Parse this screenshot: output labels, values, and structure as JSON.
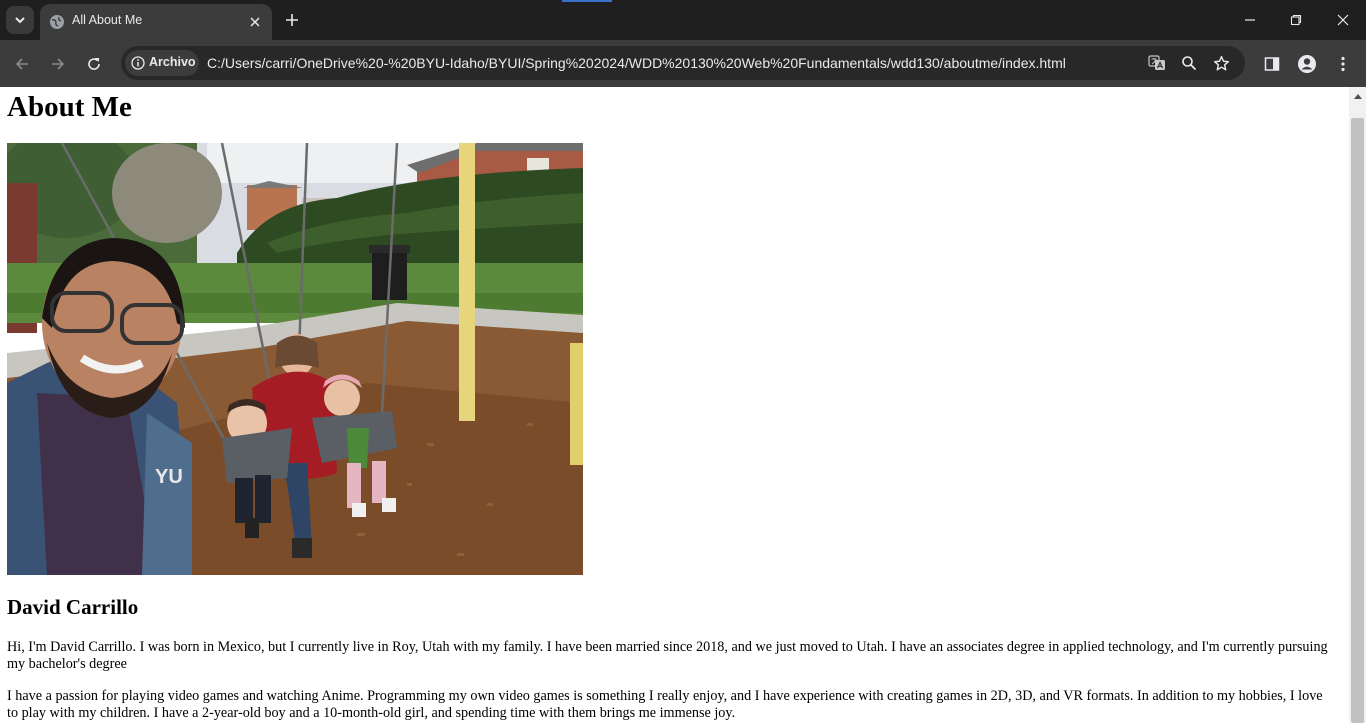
{
  "browser": {
    "tab": {
      "title": "All About Me",
      "favicon": "globe-icon"
    },
    "site_chip": {
      "label": "Archivo",
      "icon": "info-icon"
    },
    "url": "C:/Users/carri/OneDrive%20-%20BYU-Idaho/BYUI/Spring%202024/WDD%20130%20Web%20Fundamentals/wdd130/aboutme/index.html",
    "toolbar_icons": [
      "back-icon",
      "forward-icon",
      "reload-icon",
      "translate-icon",
      "zoom-icon",
      "bookmark-star-icon",
      "side-panel-icon",
      "profile-icon",
      "menu-icon"
    ],
    "colors": {
      "chrome_dark": "#1f1f1f",
      "toolbar": "#3c3c3c",
      "omnibox": "#282828",
      "text_light": "#e8eaed"
    }
  },
  "page": {
    "title": "About Me",
    "photo_description": "",
    "name": "David Carrillo",
    "paragraphs": [
      "Hi, I'm David Carrillo. I was born in Mexico, but I currently live in Roy, Utah with my family. I have been married since 2018, and we just moved to Utah. I have an associates degree in applied technology, and I'm currently pursuing my bachelor's degree",
      "I have a passion for playing video games and watching Anime. Programming my own video games is something I really enjoy, and I have experience with creating games in 2D, 3D, and VR formats. In addition to my hobbies, I love to play with my children. I have a 2-year-old boy and a 10-month-old girl, and spending time with them brings me immense joy."
    ]
  }
}
